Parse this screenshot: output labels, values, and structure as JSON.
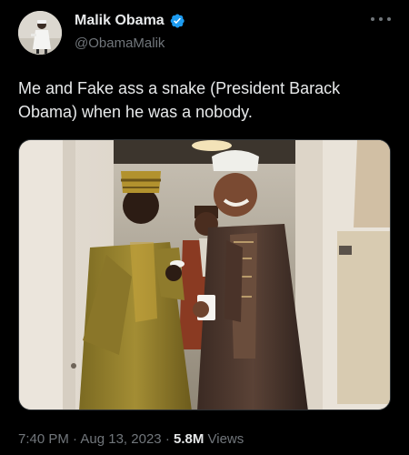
{
  "author": {
    "display_name": "Malik Obama",
    "handle": "@ObamaMalik",
    "verified": true,
    "verified_color": "#1d9bf0"
  },
  "tweet": {
    "text": "Me and Fake ass a snake (President Barack Obama) when he was a nobody."
  },
  "meta": {
    "time": "7:40 PM",
    "separator": "·",
    "date": "Aug 13, 2023",
    "views_count": "5.8M",
    "views_label": "Views"
  },
  "colors": {
    "background": "#000000",
    "text_primary": "#e7e9ea",
    "text_secondary": "#71767b"
  }
}
